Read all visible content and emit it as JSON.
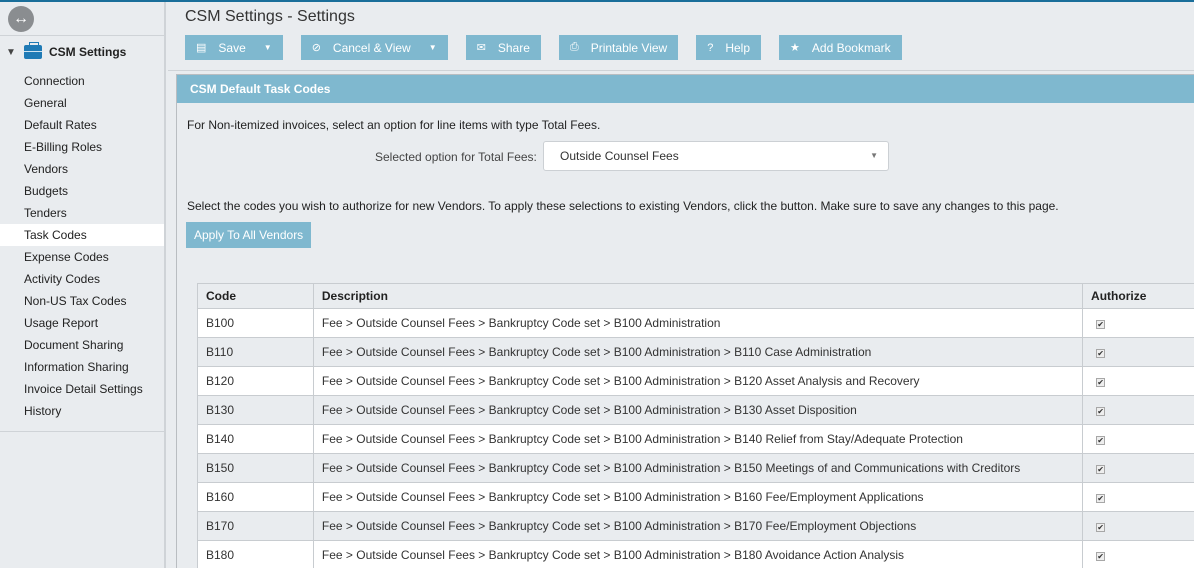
{
  "sidebar": {
    "group_label": "CSM Settings",
    "items": [
      {
        "label": "Connection"
      },
      {
        "label": "General"
      },
      {
        "label": "Default Rates"
      },
      {
        "label": "E-Billing Roles"
      },
      {
        "label": "Vendors"
      },
      {
        "label": "Budgets"
      },
      {
        "label": "Tenders"
      },
      {
        "label": "Task Codes",
        "active": true
      },
      {
        "label": "Expense Codes"
      },
      {
        "label": "Activity Codes"
      },
      {
        "label": "Non-US Tax Codes"
      },
      {
        "label": "Usage Report"
      },
      {
        "label": "Document Sharing"
      },
      {
        "label": "Information Sharing"
      },
      {
        "label": "Invoice Detail Settings"
      },
      {
        "label": "History"
      }
    ]
  },
  "header": {
    "title": "CSM Settings - Settings"
  },
  "toolbar": {
    "save_label": "Save",
    "cancel_label": "Cancel & View",
    "share_label": "Share",
    "print_label": "Printable View",
    "help_label": "Help",
    "bookmark_label": "Add Bookmark"
  },
  "panel": {
    "title": "CSM Default Task Codes",
    "intro": "For Non-itemized invoices, select an option for line items with type Total Fees.",
    "select_label": "Selected option for Total Fees:",
    "select_value": "Outside Counsel Fees",
    "intro2": "Select the codes you wish to authorize for new Vendors. To apply these selections to existing Vendors, click the button. Make sure to save any changes to this page.",
    "apply_label": "Apply To All Vendors"
  },
  "table": {
    "headers": {
      "code": "Code",
      "description": "Description",
      "authorize": "Authorize"
    },
    "rows": [
      {
        "code": "B100",
        "description": "Fee > Outside Counsel Fees > Bankruptcy Code set > B100 Administration",
        "authorized": true
      },
      {
        "code": "B110",
        "description": "Fee > Outside Counsel Fees > Bankruptcy Code set > B100 Administration > B110 Case Administration",
        "authorized": true
      },
      {
        "code": "B120",
        "description": "Fee > Outside Counsel Fees > Bankruptcy Code set > B100 Administration > B120 Asset Analysis and Recovery",
        "authorized": true
      },
      {
        "code": "B130",
        "description": "Fee > Outside Counsel Fees > Bankruptcy Code set > B100 Administration > B130 Asset Disposition",
        "authorized": true
      },
      {
        "code": "B140",
        "description": "Fee > Outside Counsel Fees > Bankruptcy Code set > B100 Administration > B140 Relief from Stay/Adequate Protection",
        "authorized": true
      },
      {
        "code": "B150",
        "description": "Fee > Outside Counsel Fees > Bankruptcy Code set > B100 Administration > B150 Meetings of and Communications with Creditors",
        "authorized": true
      },
      {
        "code": "B160",
        "description": "Fee > Outside Counsel Fees > Bankruptcy Code set > B100 Administration > B160 Fee/Employment Applications",
        "authorized": true
      },
      {
        "code": "B170",
        "description": "Fee > Outside Counsel Fees > Bankruptcy Code set > B100 Administration > B170 Fee/Employment Objections",
        "authorized": true
      },
      {
        "code": "B180",
        "description": "Fee > Outside Counsel Fees > Bankruptcy Code set > B100 Administration > B180 Avoidance Action Analysis",
        "authorized": true
      }
    ]
  },
  "colors": {
    "accent": "#7fb8cf",
    "topbar": "#1a6e9a",
    "background": "#e9ecef"
  }
}
